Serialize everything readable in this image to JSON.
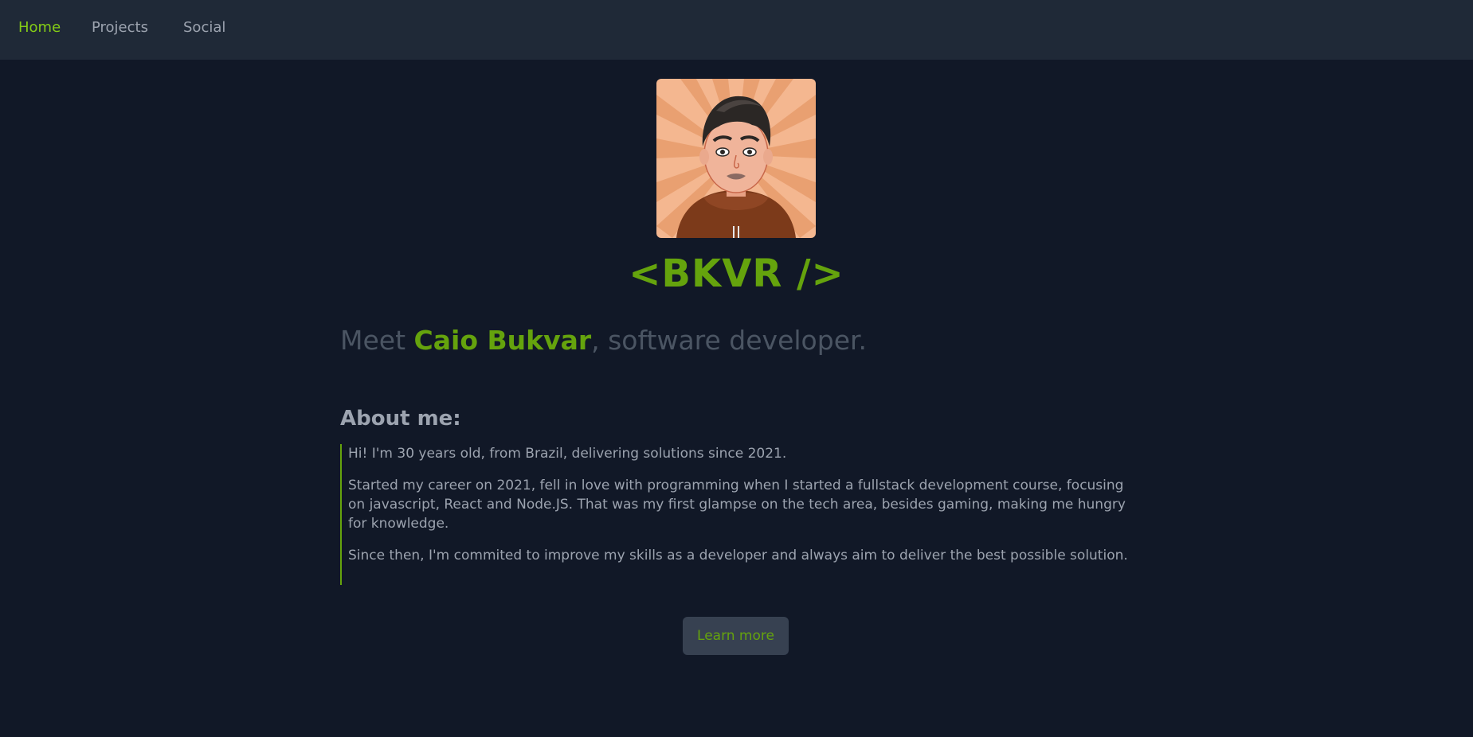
{
  "nav": {
    "items": [
      {
        "label": "Home",
        "active": true
      },
      {
        "label": "Projects",
        "active": false
      },
      {
        "label": "Social",
        "active": false
      }
    ]
  },
  "hero": {
    "avatar_icon": "cartoon-avatar",
    "logo_text": "<BKVR />",
    "headline_prefix": "Meet ",
    "headline_name": "Caio Bukvar",
    "headline_suffix": ", software developer."
  },
  "about": {
    "title": "About me:",
    "paragraphs": [
      "Hi! I'm 30 years old, from Brazil, delivering solutions since 2021.",
      "Started my career on 2021, fell in love with programming when I started a fullstack development course, focusing on javascript, React and Node.JS. That was my first glampse on the tech area, besides gaming, making me hungry for knowledge.",
      "Since then, I'm commited to improve my skills as a developer and always aim to deliver the best possible solution."
    ]
  },
  "cta": {
    "learn_more_label": "Learn more"
  },
  "colors": {
    "background": "#111827",
    "nav_background": "#1f2937",
    "accent": "#65a30d",
    "muted_text": "#9ca3af"
  }
}
